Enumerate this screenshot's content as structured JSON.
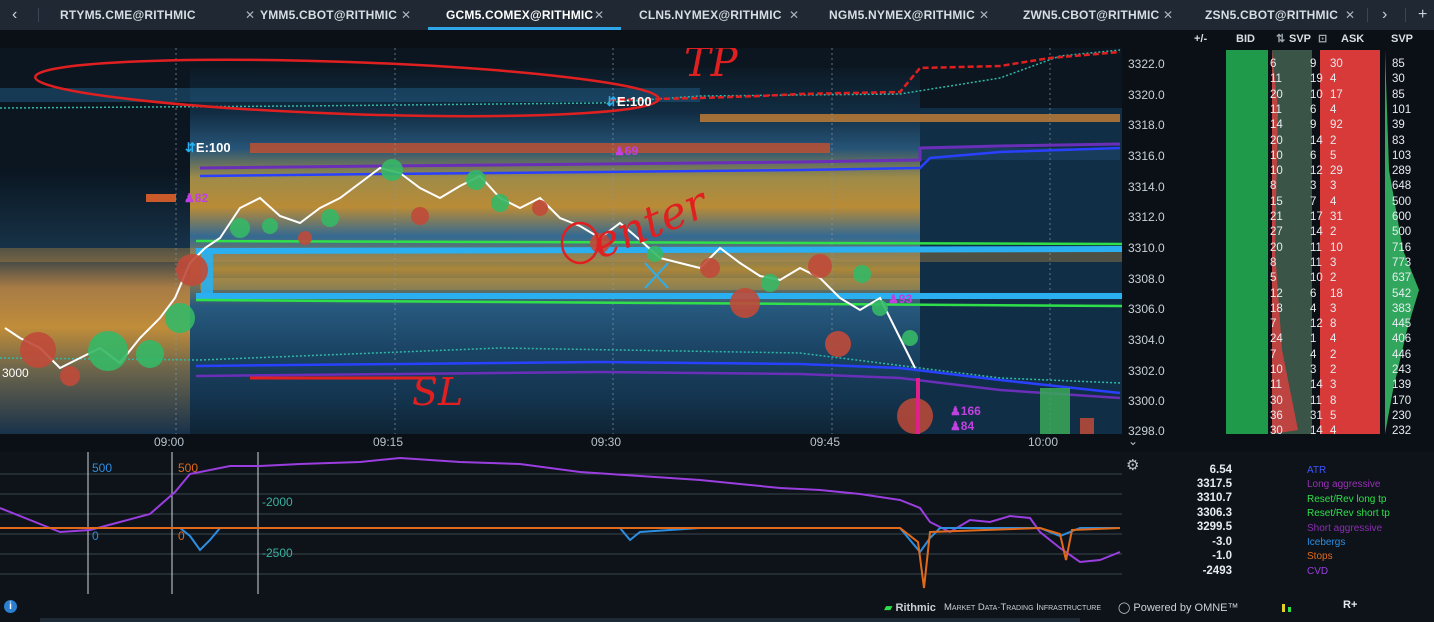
{
  "tabs": [
    {
      "label": "RTYM5.CME@RITHMIC",
      "close": "✕",
      "active": false
    },
    {
      "label": "YMM5.CBOT@RITHMIC",
      "close": "✕",
      "active": false
    },
    {
      "label": "GCM5.COMEX@RITHMIC",
      "close": "✕",
      "active": true
    },
    {
      "label": "CLN5.NYMEX@RITHMIC",
      "close": "✕",
      "active": false
    },
    {
      "label": "NGM5.NYMEX@RITHMIC",
      "close": "✕",
      "active": false
    },
    {
      "label": "ZWN5.CBOT@RITHMIC",
      "close": "✕",
      "active": false
    },
    {
      "label": "ZSN5.CBOT@RITHMIC",
      "close": "✕",
      "active": false
    }
  ],
  "nav": {
    "prev": "‹",
    "next": "›",
    "add": "+"
  },
  "dom_headers": {
    "plusminus": "+/-",
    "bid": "BID",
    "svp_left": "SVP",
    "ask": "ASK",
    "svp_right": "SVP"
  },
  "price_labels": [
    "3322.0",
    "3320.0",
    "3318.0",
    "3316.0",
    "3314.0",
    "3312.0",
    "3310.0",
    "3308.0",
    "3306.0",
    "3304.0",
    "3302.0",
    "3300.0",
    "3298.0"
  ],
  "dom_rows": [
    {
      "a": "6",
      "b": "9",
      "c": "30",
      "d": "85"
    },
    {
      "a": "11",
      "b": "19",
      "c": "4",
      "d": "30"
    },
    {
      "a": "20",
      "b": "10",
      "c": "17",
      "d": "85"
    },
    {
      "a": "11",
      "b": "6",
      "c": "4",
      "d": "101"
    },
    {
      "a": "14",
      "b": "9",
      "c": "92",
      "d": "39"
    },
    {
      "a": "20",
      "b": "14",
      "c": "2",
      "d": "83"
    },
    {
      "a": "10",
      "b": "6",
      "c": "5",
      "d": "103"
    },
    {
      "a": "10",
      "b": "12",
      "c": "29",
      "d": "289"
    },
    {
      "a": "8",
      "b": "3",
      "c": "3",
      "d": "648"
    },
    {
      "a": "15",
      "b": "7",
      "c": "4",
      "d": "500"
    },
    {
      "a": "21",
      "b": "17",
      "c": "31",
      "d": "600"
    },
    {
      "a": "27",
      "b": "14",
      "c": "2",
      "d": "500"
    },
    {
      "a": "20",
      "b": "11",
      "c": "10",
      "d": "716"
    },
    {
      "a": "8",
      "b": "11",
      "c": "3",
      "d": "773"
    },
    {
      "a": "5",
      "b": "10",
      "c": "2",
      "d": "637"
    },
    {
      "a": "12",
      "b": "6",
      "c": "18",
      "d": "542"
    },
    {
      "a": "18",
      "b": "4",
      "c": "3",
      "d": "383"
    },
    {
      "a": "7",
      "b": "12",
      "c": "8",
      "d": "445"
    },
    {
      "a": "24",
      "b": "1",
      "c": "4",
      "d": "406"
    },
    {
      "a": "7",
      "b": "4",
      "c": "2",
      "d": "446"
    },
    {
      "a": "10",
      "b": "3",
      "c": "2",
      "d": "243"
    },
    {
      "a": "11",
      "b": "14",
      "c": "3",
      "d": "139"
    },
    {
      "a": "30",
      "b": "11",
      "c": "8",
      "d": "170"
    },
    {
      "a": "36",
      "b": "31",
      "c": "5",
      "d": "230"
    },
    {
      "a": "30",
      "b": "14",
      "c": "4",
      "d": "232"
    }
  ],
  "time_labels": [
    "09:00",
    "09:15",
    "09:30",
    "09:45",
    "10:00"
  ],
  "chart_labels": {
    "e100_left": "E:100",
    "e100_top": "E:100",
    "b82": "82",
    "b69": "69",
    "b93": "93",
    "b166": "166",
    "b84": "84",
    "left_price": "3000",
    "ann_tp": "TP",
    "ann_enter": "enter",
    "ann_sl": "SL"
  },
  "lower_labels": {
    "l500a": "500",
    "l0a": "0",
    "l500b": "500",
    "l0b": "0",
    "m2000": "-2000",
    "m2500": "-2500"
  },
  "stats": {
    "values": [
      "6.54",
      "3317.5",
      "3310.7",
      "3306.3",
      "3299.5",
      "-3.0",
      "-1.0",
      "-2493"
    ],
    "legend": [
      {
        "label": "ATR",
        "color": "#3d54ff"
      },
      {
        "label": "Long aggressive",
        "color": "#9a2fb8"
      },
      {
        "label": "Reset/Rev long tp",
        "color": "#2fe04a"
      },
      {
        "label": "Reset/Rev short tp",
        "color": "#2fe04a"
      },
      {
        "label": "Short aggressive",
        "color": "#8a2fb0"
      },
      {
        "label": "Icebergs",
        "color": "#2d8ee0"
      },
      {
        "label": "Stops",
        "color": "#e06a1a"
      },
      {
        "label": "CVD",
        "color": "#9b3ee0"
      }
    ]
  },
  "footer": {
    "brand": "Rithmic",
    "brand_tag": "Market Data·Trading Infrastructure",
    "powered": "Powered by OMNE™",
    "rplus": "R+",
    "info": "i"
  }
}
